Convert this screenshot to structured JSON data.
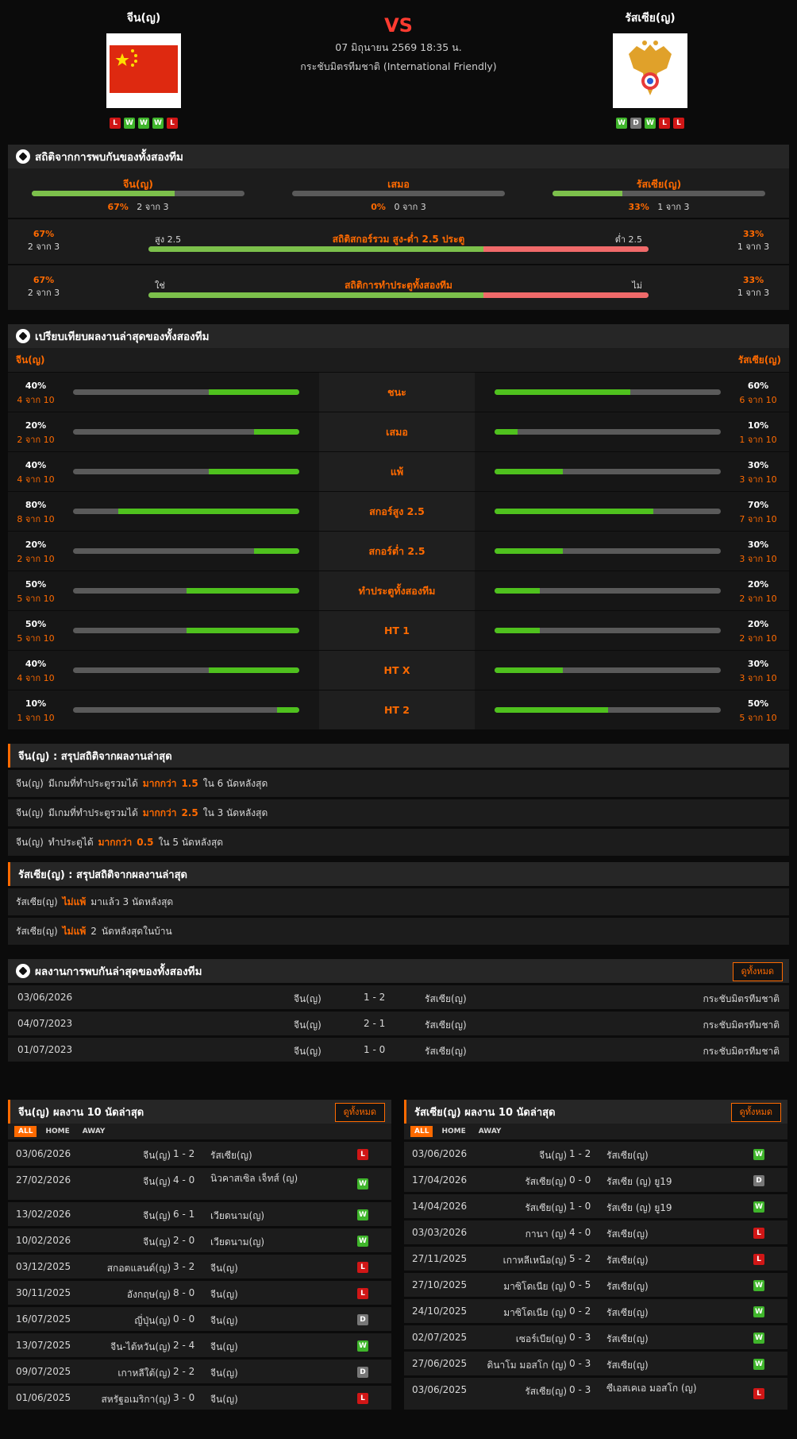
{
  "header": {
    "home": "จีน(ญ)",
    "away": "รัสเซีย(ญ)",
    "vs": "VS",
    "date": "07 มิถุนายน 2569 18:35 น.",
    "league": "กระชับมิตรทีมชาติ (International Friendly)",
    "home_form": [
      "L",
      "W",
      "W",
      "W",
      "L"
    ],
    "away_form": [
      "W",
      "D",
      "W",
      "L",
      "L"
    ]
  },
  "colors": {
    "accent": "#ff6a00",
    "win": "#3fb52b",
    "loss": "#d01616",
    "draw": "#777777",
    "bar_green": "#7cc04b",
    "bar_red": "#f06a6a"
  },
  "h2h_stats": {
    "title": "สถิติจากการพบกันของทั้งสองทีม",
    "home": {
      "label": "จีน(ญ)",
      "pct": "67%",
      "count": "2 จาก 3",
      "fill": 0.67
    },
    "draw": {
      "label": "เสมอ",
      "pct": "0%",
      "count": "0 จาก 3",
      "fill": 0
    },
    "away": {
      "label": "รัสเซีย(ญ)",
      "pct": "33%",
      "count": "1 จาก 3",
      "fill": 0.33
    }
  },
  "ou_stats": {
    "title": "สถิติสกอร์รวม สูง-ต่ำ 2.5 ประตู",
    "left_label": "สูง 2.5",
    "right_label": "ต่ำ 2.5",
    "left_pct": "67%",
    "left_count": "2 จาก 3",
    "right_pct": "33%",
    "right_count": "1 จาก 3",
    "fill": 0.67
  },
  "btts_stats": {
    "title": "สถิติการทำประตูทั้งสองทีม",
    "left_label": "ใช่",
    "right_label": "ไม่",
    "left_pct": "67%",
    "left_count": "2 จาก 3",
    "right_pct": "33%",
    "right_count": "1 จาก 3",
    "fill": 0.67
  },
  "compare": {
    "title": "เปรียบเทียบผลงานล่าสุดของทั้งสองทีม",
    "home": "จีน(ญ)",
    "away": "รัสเซีย(ญ)",
    "rows": [
      {
        "label": "ชนะ",
        "hp": "40%",
        "hc": "4 จาก 10",
        "hf": 0.4,
        "ap": "60%",
        "ac": "6 จาก 10",
        "af": 0.6
      },
      {
        "label": "เสมอ",
        "hp": "20%",
        "hc": "2 จาก 10",
        "hf": 0.2,
        "ap": "10%",
        "ac": "1 จาก 10",
        "af": 0.1
      },
      {
        "label": "แพ้",
        "hp": "40%",
        "hc": "4 จาก 10",
        "hf": 0.4,
        "ap": "30%",
        "ac": "3 จาก 10",
        "af": 0.3
      },
      {
        "label": "สกอร์สูง 2.5",
        "hp": "80%",
        "hc": "8 จาก 10",
        "hf": 0.8,
        "ap": "70%",
        "ac": "7 จาก 10",
        "af": 0.7
      },
      {
        "label": "สกอร์ต่ำ 2.5",
        "hp": "20%",
        "hc": "2 จาก 10",
        "hf": 0.2,
        "ap": "30%",
        "ac": "3 จาก 10",
        "af": 0.3
      },
      {
        "label": "ทำประตูทั้งสองทีม",
        "hp": "50%",
        "hc": "5 จาก 10",
        "hf": 0.5,
        "ap": "20%",
        "ac": "2 จาก 10",
        "af": 0.2
      },
      {
        "label": "HT 1",
        "hp": "50%",
        "hc": "5 จาก 10",
        "hf": 0.5,
        "ap": "20%",
        "ac": "2 จาก 10",
        "af": 0.2
      },
      {
        "label": "HT X",
        "hp": "40%",
        "hc": "4 จาก 10",
        "hf": 0.4,
        "ap": "30%",
        "ac": "3 จาก 10",
        "af": 0.3
      },
      {
        "label": "HT 2",
        "hp": "10%",
        "hc": "1 จาก 10",
        "hf": 0.1,
        "ap": "50%",
        "ac": "5 จาก 10",
        "af": 0.5
      }
    ]
  },
  "home_summary": {
    "title": "จีน(ญ) : สรุปสถิติจากผลงานล่าสุด",
    "rows": [
      [
        "จีน(ญ)",
        "มีเกมที่ทำประตูรวมได้",
        "มากกว่า",
        "1.5",
        "ใน 6 นัดหลังสุด"
      ],
      [
        "จีน(ญ)",
        "มีเกมที่ทำประตูรวมได้",
        "มากกว่า",
        "2.5",
        "ใน 3 นัดหลังสุด"
      ],
      [
        "จีน(ญ)",
        "ทำประตูได้",
        "มากกว่า",
        "0.5",
        "ใน 5 นัดหลังสุด"
      ]
    ]
  },
  "away_summary": {
    "title": "รัสเซีย(ญ) : สรุปสถิติจากผลงานล่าสุด",
    "rows": [
      [
        "รัสเซีย(ญ)",
        "ไม่แพ้",
        "มาแล้ว 3 นัดหลังสุด"
      ],
      [
        "รัสเซีย(ญ)",
        "ไม่แพ้",
        "2",
        "นัดหลังสุดในบ้าน"
      ]
    ]
  },
  "h2h": {
    "title": "ผลงานการพบกันล่าสุดของทั้งสองทีม",
    "button": "ดูทั้งหมด",
    "rows": [
      [
        "03/06/2026",
        "จีน(ญ)",
        "1 - 2",
        "รัสเซีย(ญ)",
        "กระชับมิตรทีมชาติ"
      ],
      [
        "04/07/2023",
        "จีน(ญ)",
        "2 - 1",
        "รัสเซีย(ญ)",
        "กระชับมิตรทีมชาติ"
      ],
      [
        "01/07/2023",
        "จีน(ญ)",
        "1 - 0",
        "รัสเซีย(ญ)",
        "กระชับมิตรทีมชาติ"
      ]
    ]
  },
  "tabs": [
    "ALL",
    "HOME",
    "AWAY"
  ],
  "home_last": {
    "title": "จีน(ญ) ผลงาน 10 นัดล่าสุด",
    "button": "ดูทั้งหมด",
    "rows": [
      [
        "03/06/2026",
        "จีน(ญ)",
        "1 - 2",
        "รัสเซีย(ญ)",
        "L"
      ],
      [
        "27/02/2026",
        "จีน(ญ)",
        "4 - 0",
        "นิวคาสเซิล เจ็ทส์ (ญ)",
        "W"
      ],
      [
        "13/02/2026",
        "จีน(ญ)",
        "6 - 1",
        "เวียดนาม(ญ)",
        "W"
      ],
      [
        "10/02/2026",
        "จีน(ญ)",
        "2 - 0",
        "เวียดนาม(ญ)",
        "W"
      ],
      [
        "03/12/2025",
        "สกอตแลนด์(ญ)",
        "3 - 2",
        "จีน(ญ)",
        "L"
      ],
      [
        "30/11/2025",
        "อังกฤษ(ญ)",
        "8 - 0",
        "จีน(ญ)",
        "L"
      ],
      [
        "16/07/2025",
        "ญี่ปุ่น(ญ)",
        "0 - 0",
        "จีน(ญ)",
        "D"
      ],
      [
        "13/07/2025",
        "จีน-ไต้หวัน(ญ)",
        "2 - 4",
        "จีน(ญ)",
        "W"
      ],
      [
        "09/07/2025",
        "เกาหลีใต้(ญ)",
        "2 - 2",
        "จีน(ญ)",
        "D"
      ],
      [
        "01/06/2025",
        "สหรัฐอเมริกา(ญ)",
        "3 - 0",
        "จีน(ญ)",
        "L"
      ]
    ]
  },
  "away_last": {
    "title": "รัสเซีย(ญ) ผลงาน 10 นัดล่าสุด",
    "button": "ดูทั้งหมด",
    "rows": [
      [
        "03/06/2026",
        "จีน(ญ)",
        "1 - 2",
        "รัสเซีย(ญ)",
        "W"
      ],
      [
        "17/04/2026",
        "รัสเซีย(ญ)",
        "0 - 0",
        "รัสเซีย (ญ) ยู19",
        "D"
      ],
      [
        "14/04/2026",
        "รัสเซีย(ญ)",
        "1 - 0",
        "รัสเซีย (ญ) ยู19",
        "W"
      ],
      [
        "03/03/2026",
        "กานา (ญ)",
        "4 - 0",
        "รัสเซีย(ญ)",
        "L"
      ],
      [
        "27/11/2025",
        "เกาหลีเหนือ(ญ)",
        "5 - 2",
        "รัสเซีย(ญ)",
        "L"
      ],
      [
        "27/10/2025",
        "มาซิโดเนีย (ญ)",
        "0 - 5",
        "รัสเซีย(ญ)",
        "W"
      ],
      [
        "24/10/2025",
        "มาซิโดเนีย (ญ)",
        "0 - 2",
        "รัสเซีย(ญ)",
        "W"
      ],
      [
        "02/07/2025",
        "เซอร์เบีย(ญ)",
        "0 - 3",
        "รัสเซีย(ญ)",
        "W"
      ],
      [
        "27/06/2025",
        "ดินาโม มอสโก (ญ)",
        "0 - 3",
        "รัสเซีย(ญ)",
        "W"
      ],
      [
        "03/06/2025",
        "รัสเซีย(ญ)",
        "0 - 3",
        "ซีเอสเคเอ มอสโก (ญ)",
        "L"
      ]
    ]
  }
}
